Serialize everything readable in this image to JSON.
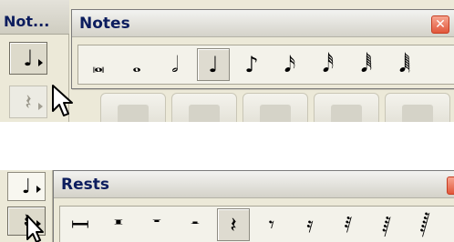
{
  "top": {
    "mini_palette_title": "Not...",
    "mini_tools": [
      {
        "icon": "quarter-note-icon",
        "glyph": "♩"
      },
      {
        "icon": "quarter-rest-icon",
        "glyph": "𝄽"
      }
    ],
    "palette": {
      "title": "Notes",
      "close_glyph": "✕",
      "tools": [
        {
          "name": "tool-breve",
          "icon": "double-whole-note-icon",
          "glyph": "𝅜"
        },
        {
          "name": "tool-whole",
          "icon": "whole-note-icon",
          "glyph": "𝅝"
        },
        {
          "name": "tool-half",
          "icon": "half-note-icon",
          "glyph": "𝅗𝅥"
        },
        {
          "name": "tool-quarter",
          "icon": "quarter-note-icon",
          "glyph": "♩",
          "selected": true
        },
        {
          "name": "tool-eighth",
          "icon": "eighth-note-icon",
          "glyph": "♪"
        },
        {
          "name": "tool-sixteenth",
          "icon": "sixteenth-note-icon",
          "glyph": "𝅘𝅥𝅯"
        },
        {
          "name": "tool-thirty-second",
          "icon": "thirty-second-note-icon",
          "glyph": "𝅘𝅥𝅰"
        },
        {
          "name": "tool-sixty-fourth",
          "icon": "sixty-fourth-note-icon",
          "glyph": "𝅘𝅥𝅱"
        },
        {
          "name": "tool-hundred-twenty-eighth",
          "icon": "hundred-twenty-eighth-note-icon",
          "glyph": "𝅘𝅥𝅲"
        }
      ]
    }
  },
  "bottom": {
    "side_tools": [
      {
        "icon": "quarter-note-icon",
        "glyph": "♩"
      },
      {
        "icon": "quarter-rest-icon",
        "glyph": "𝄽"
      }
    ],
    "palette": {
      "title": "Rests",
      "tools": [
        {
          "name": "tool-multimeasure-rest",
          "icon": "multimeasure-rest-icon",
          "glyph": "𝄩"
        },
        {
          "name": "tool-breve-rest",
          "icon": "double-whole-rest-icon",
          "glyph": "𝄺"
        },
        {
          "name": "tool-whole-rest",
          "icon": "whole-rest-icon",
          "glyph": "𝄻"
        },
        {
          "name": "tool-half-rest",
          "icon": "half-rest-icon",
          "glyph": "𝄼"
        },
        {
          "name": "tool-quarter-rest",
          "icon": "quarter-rest-icon",
          "glyph": "𝄽",
          "selected": true
        },
        {
          "name": "tool-eighth-rest",
          "icon": "eighth-rest-icon",
          "glyph": "𝄾"
        },
        {
          "name": "tool-sixteenth-rest",
          "icon": "sixteenth-rest-icon",
          "glyph": "𝄿"
        },
        {
          "name": "tool-thirty-second-rest",
          "icon": "thirty-second-rest-icon",
          "glyph": "𝅀"
        },
        {
          "name": "tool-sixty-fourth-rest",
          "icon": "sixty-fourth-rest-icon",
          "glyph": "𝅁"
        },
        {
          "name": "tool-hundred-twenty-eighth-rest",
          "icon": "hundred-twenty-eighth-rest-icon",
          "glyph": "𝅂"
        }
      ]
    }
  }
}
